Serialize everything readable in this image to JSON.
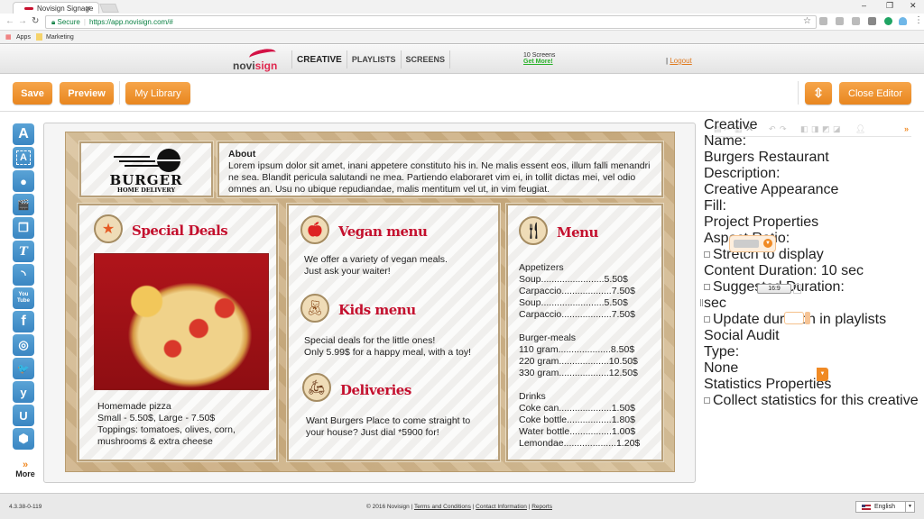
{
  "browser": {
    "tab_title": "Novisign Signage",
    "secure_label": "Secure",
    "url": "https://app.novisign.com/#",
    "bookmarks": [
      "Apps",
      "Marketing"
    ]
  },
  "header": {
    "logo_prefix": "novi",
    "logo_suffix": "sign",
    "nav": [
      "CREATIVE",
      "PLAYLISTS",
      "SCREENS"
    ],
    "active_nav": "CREATIVE",
    "screens_count": "10 Screens",
    "get_more": "Get More!",
    "logout": "Logout"
  },
  "toolbar": {
    "save": "Save",
    "preview": "Preview",
    "library": "My Library",
    "close_editor": "Close Editor"
  },
  "left_sidebar": {
    "items": [
      "text",
      "text-box",
      "camera",
      "video",
      "gallery",
      "ticker",
      "rss",
      "youtube",
      "facebook",
      "instagram",
      "twitter",
      "yammer",
      "ustream",
      "widget"
    ],
    "glyphs": [
      "A",
      "A",
      "●",
      "🎬",
      "❐",
      "T",
      "◝",
      "You Tube",
      "f",
      "◎",
      "🐦",
      "y",
      "U",
      "⬢"
    ],
    "more_label": "More"
  },
  "creative": {
    "logo_title": "BURGER",
    "logo_subtitle": "HOME DELIVERY",
    "about_title": "About",
    "about_text": "Lorem ipsum dolor sit amet, inani appetere constituto his in. Ne malis essent eos, illum falli menandri ne sea. Blandit pericula salutandi ne mea. Partiendo elaboraret vim ei, in tollit dictas mei, vel odio omnes an. Usu no ubique repudiandae, malis mentitum vel ut, in vim feugiat.",
    "special": {
      "title": "Special Deals",
      "lines": [
        "Homemade pizza",
        "Small - 5.50$, Large - 7.50$",
        "Toppings: tomatoes, olives, corn,",
        "mushrooms & extra cheese"
      ]
    },
    "vegan": {
      "title": "Vegan menu",
      "text": [
        "We offer a variety of vegan meals.",
        "Just ask your waiter!"
      ]
    },
    "kids": {
      "title": "Kids menu",
      "text": [
        "Special deals for the little ones!",
        "Only 5.99$ for a happy meal, with a toy!"
      ]
    },
    "deliveries": {
      "title": "Deliveries",
      "text": [
        "Want Burgers Place to come straight to",
        "your house? Just dial *5900 for!"
      ]
    },
    "menu": {
      "title": "Menu",
      "sections": [
        {
          "name": "Appetizers",
          "items": [
            [
              "Soup",
              "5.50$"
            ],
            [
              "Carpaccio",
              "7.50$"
            ],
            [
              "Soup",
              "5.50$"
            ],
            [
              "Carpaccio",
              "7.50$"
            ]
          ]
        },
        {
          "name": "Burger-meals",
          "items": [
            [
              "110 gram",
              "8.50$"
            ],
            [
              "220 gram",
              "10.50$"
            ],
            [
              "330 gram",
              "12.50$"
            ]
          ]
        },
        {
          "name": "Drinks",
          "items": [
            [
              "Coke can",
              "1.50$"
            ],
            [
              "Coke bottle",
              "1.80$"
            ],
            [
              "Water bottle",
              "1.00$"
            ],
            [
              "Lemondae",
              "1.20$"
            ]
          ]
        }
      ]
    }
  },
  "properties": {
    "creative_heading": "Creative",
    "name_label": "Name:",
    "name_value": "Burgers Restaurant",
    "description_label": "Description:",
    "description_value": "",
    "appearance_heading": "Creative Appearance",
    "fill_label": "Fill:",
    "project_heading": "Project Properties",
    "aspect_label": "Aspect Ratio:",
    "aspect_value": "16:9",
    "stretch_label": "Stretch to display",
    "content_duration_label": "Content Duration:",
    "content_duration_value": "10 sec",
    "suggested_label": "Suggested Duration:",
    "sec_label": "sec",
    "update_label": "Update duration in playlists",
    "social_heading": "Social Audit",
    "type_label": "Type:",
    "type_value": "None",
    "stats_heading": "Statistics Properties",
    "stats_label": "Collect statistics for this creative"
  },
  "footer": {
    "version": "4.3.38-0-119",
    "copyright": "© 2016 Novisign",
    "links": [
      "Terms and Conditions",
      "Contact Information",
      "Reports"
    ],
    "language": "English"
  },
  "colors": {
    "accent": "#f08a24",
    "brand_red": "#c4102e",
    "icon_blue": "#4a95cc"
  }
}
